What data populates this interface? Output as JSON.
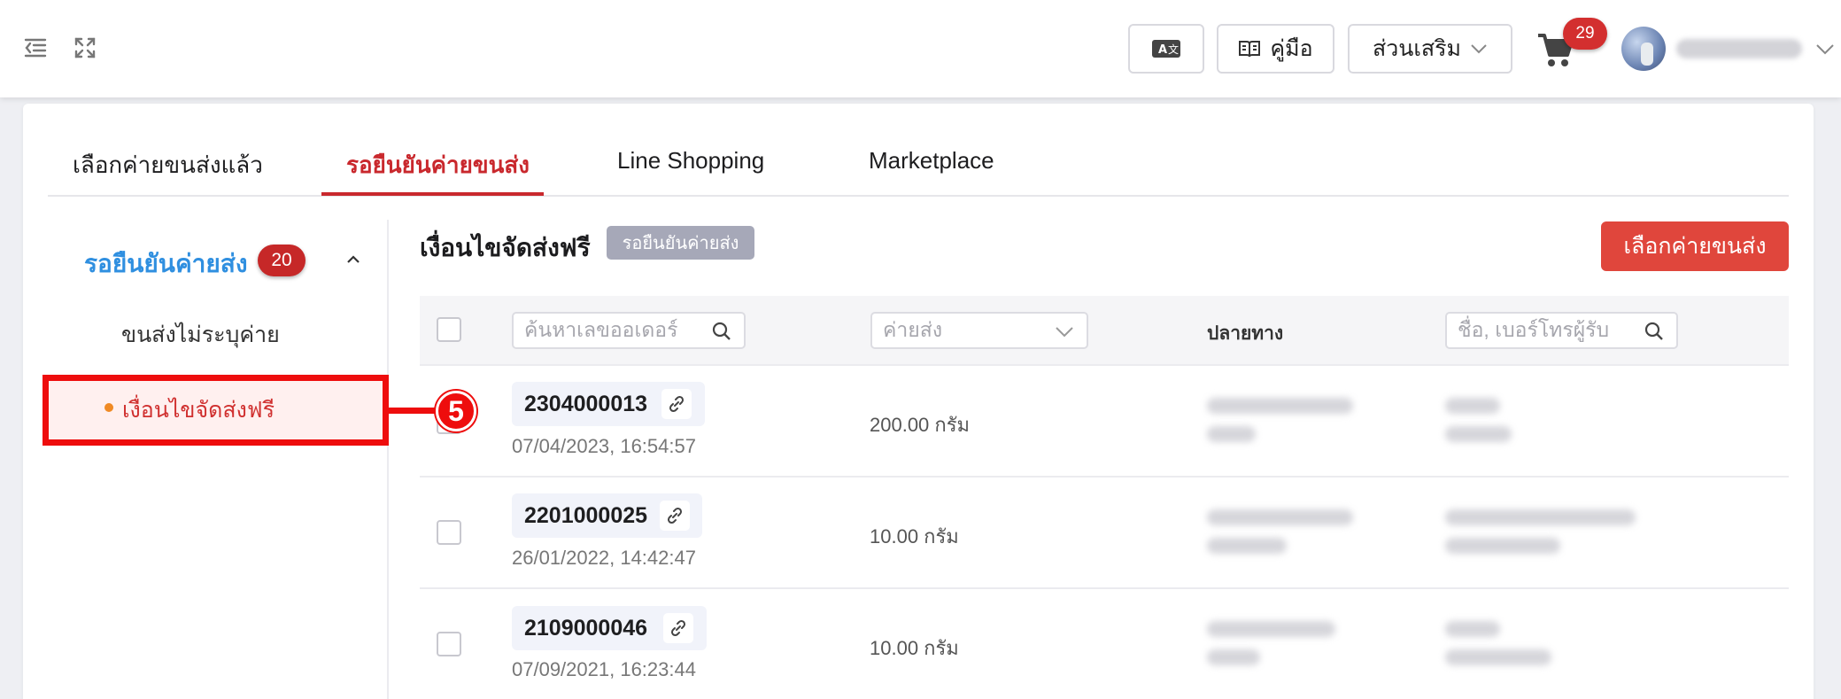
{
  "topbar": {
    "guide_label": "คู่มือ",
    "extras_label": "ส่วนเสริม",
    "cart_count": "29"
  },
  "tabs": [
    {
      "label": "เลือกค่ายขนส่งแล้ว",
      "active": false
    },
    {
      "label": "รอยืนยันค่ายขนส่ง",
      "active": true
    },
    {
      "label": "Line Shopping",
      "active": false
    },
    {
      "label": "Marketplace",
      "active": false
    }
  ],
  "sidebar": {
    "title": "รอยืนยันค่ายส่ง",
    "badge": "20",
    "items": [
      {
        "label": "ขนส่งไม่ระบุค่าย",
        "active": false
      },
      {
        "label": "เงื่อนไขจัดส่งฟรี",
        "active": true
      }
    ]
  },
  "annotation": {
    "number": "5",
    "color": "#ee0d0d"
  },
  "content": {
    "title": "เงื่อนไขจัดส่งฟรี",
    "status_chip": "รอยืนยันค่ายส่ง",
    "primary_button": "เลือกค่ายขนส่ง"
  },
  "table": {
    "order_search_placeholder": "ค้นหาเลขออเดอร์",
    "carrier_placeholder": "ค่ายส่ง",
    "destination_header": "ปลายทาง",
    "recipient_search_placeholder": "ชื่อ, เบอร์โทรผู้รับ",
    "rows": [
      {
        "order_no": "2304000013",
        "date": "07/04/2023, 16:54:57",
        "weight": "200.00 กรัม"
      },
      {
        "order_no": "2201000025",
        "date": "26/01/2022, 14:42:47",
        "weight": "10.00 กรัม"
      },
      {
        "order_no": "2109000046",
        "date": "07/09/2021, 16:23:44",
        "weight": "10.00 กรัม"
      }
    ]
  },
  "colors": {
    "accent_red": "#c9282d",
    "sidebar_blue": "#2f8fe0",
    "button_red": "#e0463c"
  }
}
